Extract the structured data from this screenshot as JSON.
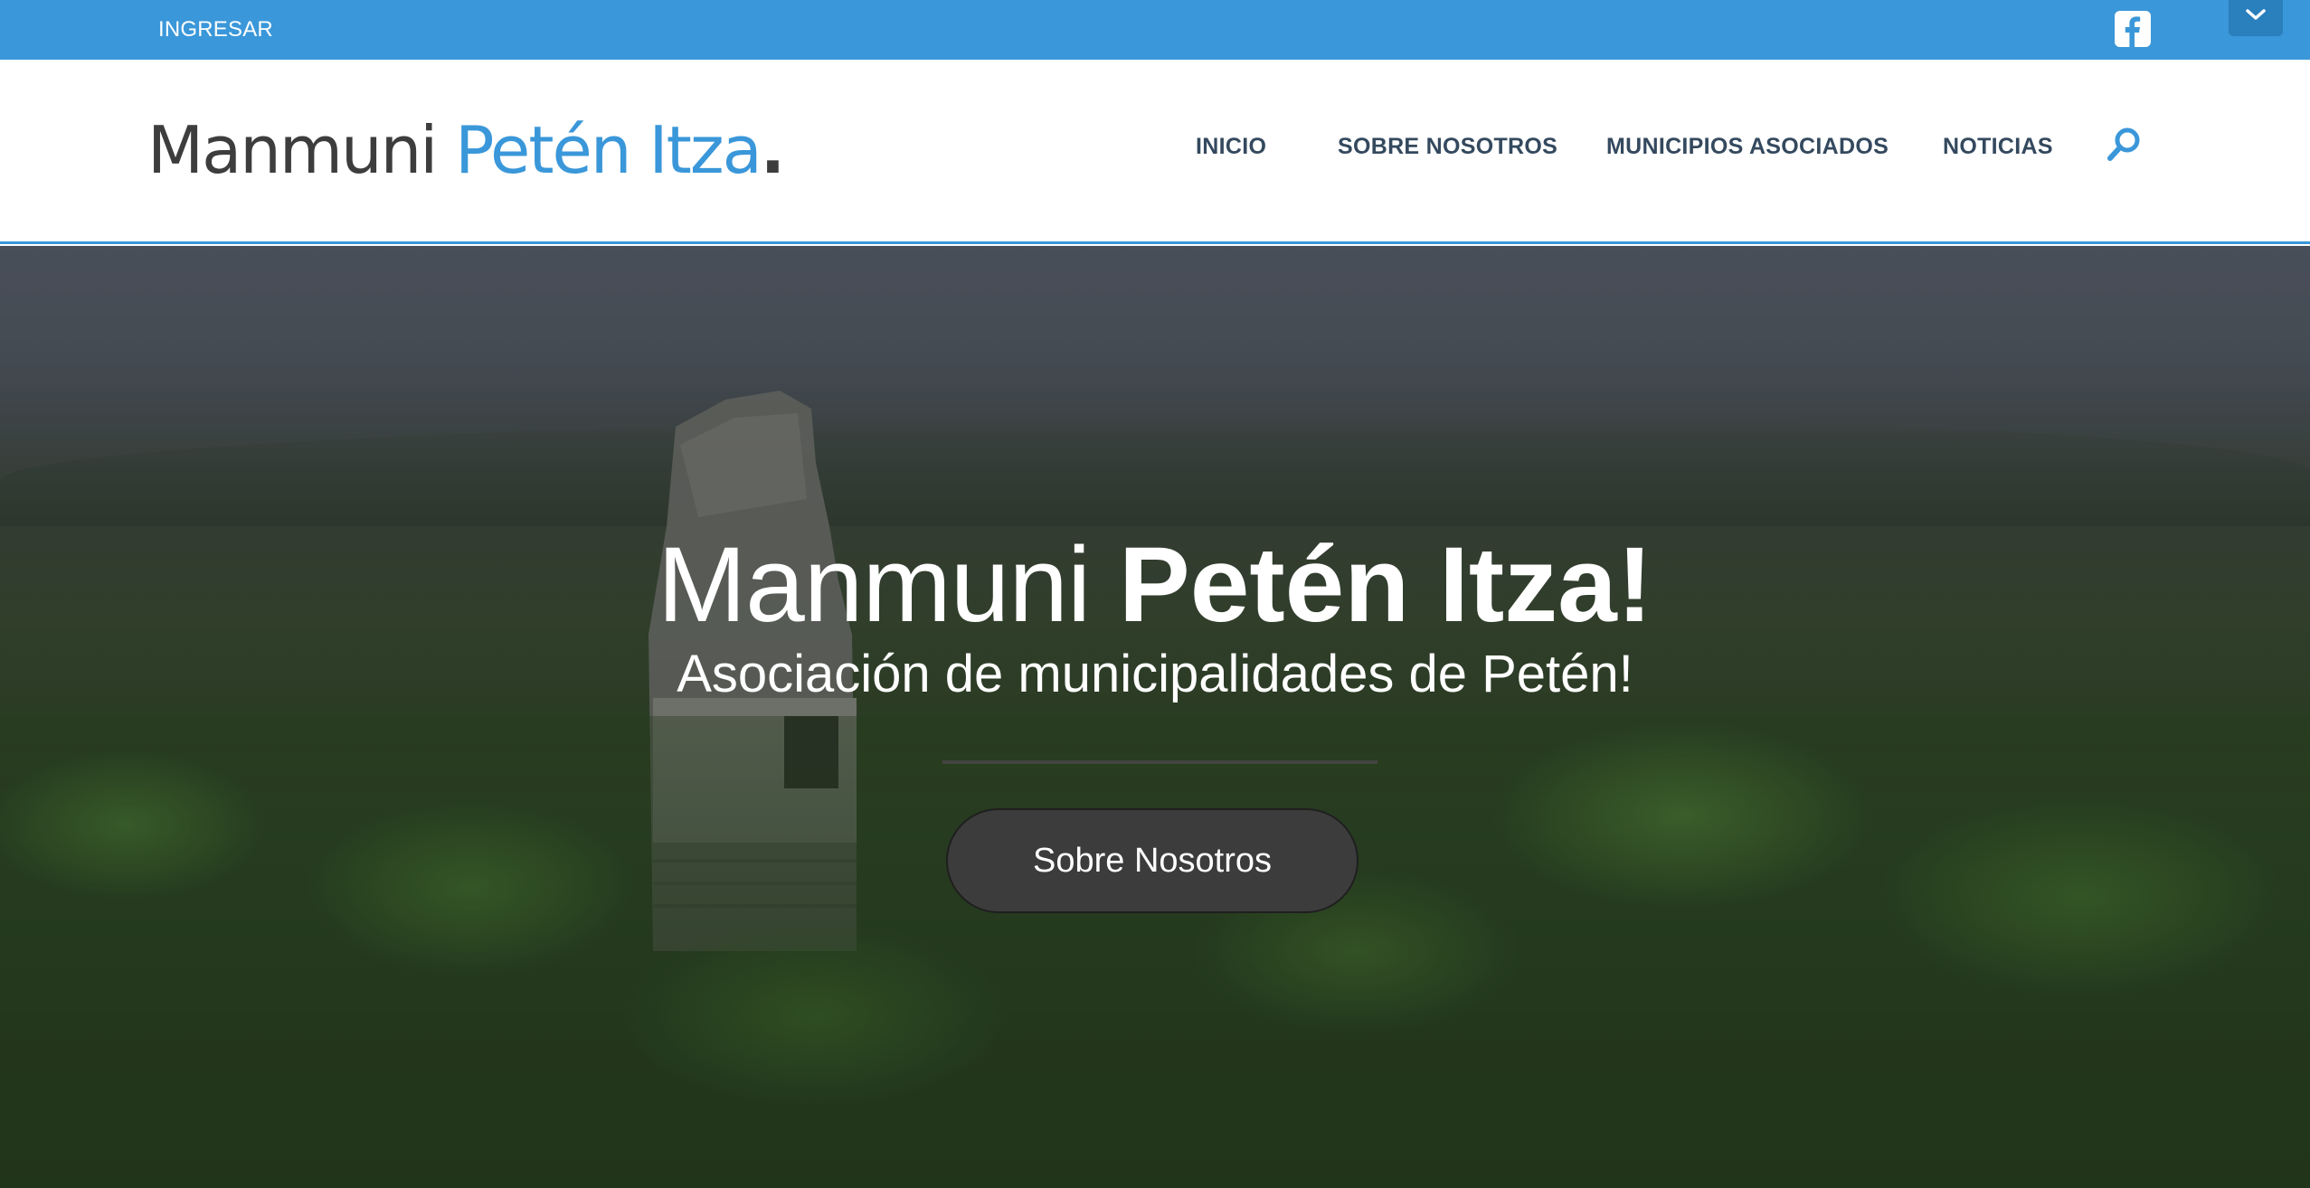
{
  "topbar": {
    "login_label": "INGRESAR",
    "facebook_icon": "facebook-icon",
    "toggle_icon": "chevron-down-icon",
    "color": "#3a97d9"
  },
  "header": {
    "logo": {
      "part1": "Manmuni ",
      "part2": "Petén Itza",
      "part3": "."
    },
    "nav": [
      {
        "label": "INICIO"
      },
      {
        "label": "SOBRE NOSOTROS"
      },
      {
        "label": "MUNICIPIOS ASOCIADOS"
      },
      {
        "label": "NOTICIAS"
      }
    ],
    "search_icon": "search-icon"
  },
  "hero": {
    "title_light": "Manmuni ",
    "title_bold": "Petén Itza!",
    "subtitle": "Asociación de municipalidades de Petén!",
    "cta_label": "Sobre Nosotros"
  },
  "colors": {
    "accent": "#3a97d9",
    "nav_text": "#34495e",
    "logo_dark": "#3d3d3d",
    "cta_bg": "#3c3c3c"
  }
}
